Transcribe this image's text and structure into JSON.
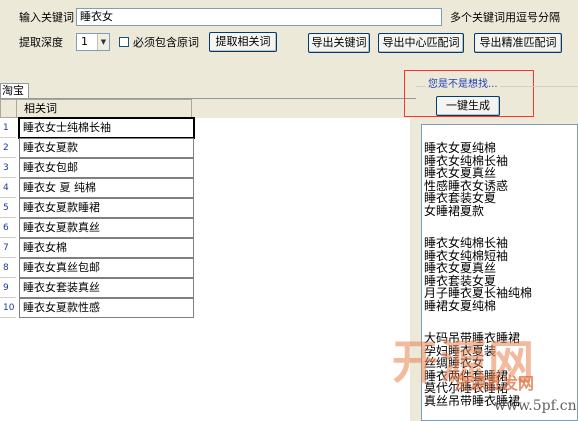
{
  "toolbar": {
    "keyword_label": "输入关键词",
    "keyword_value": "睡衣女",
    "keyword_hint": "多个关键词用逗号分隔",
    "depth_label": "提取深度",
    "depth_value": "1",
    "must_contain_label": "必须包含原词",
    "extract_button": "提取相关词",
    "export_keywords_button": "导出关键词",
    "export_center_button": "导出中心匹配词",
    "export_precise_button": "导出精准匹配词"
  },
  "tab": {
    "label": "淘宝"
  },
  "grid": {
    "header": "相关词",
    "rows": [
      {
        "num": "1",
        "text": "睡衣女士纯棉长袖"
      },
      {
        "num": "2",
        "text": "睡衣女夏款"
      },
      {
        "num": "3",
        "text": "睡衣女包邮"
      },
      {
        "num": "4",
        "text": "睡衣女 夏 纯棉"
      },
      {
        "num": "5",
        "text": "睡衣女夏款睡裙"
      },
      {
        "num": "6",
        "text": "睡衣女夏款真丝"
      },
      {
        "num": "7",
        "text": "睡衣女棉"
      },
      {
        "num": "8",
        "text": "睡衣女真丝包邮"
      },
      {
        "num": "9",
        "text": "睡衣女套装真丝"
      },
      {
        "num": "10",
        "text": "睡衣女夏款性感"
      }
    ]
  },
  "suggest": {
    "title": "您是不是想找...",
    "button": "一键生成"
  },
  "results": {
    "group1": [
      "睡衣女夏纯棉",
      "睡衣女纯棉长袖",
      "睡衣女夏真丝",
      "性感睡衣女诱惑",
      "睡衣套装女夏",
      "女睡裙夏款"
    ],
    "group2": [
      "睡衣女纯棉长袖",
      "睡衣女纯棉短袖",
      "睡衣女夏真丝",
      "睡衣套装女夏",
      "月子睡衣夏长袖纯棉",
      "睡裙女夏纯棉"
    ],
    "group3": [
      "大码吊带睡衣睡裙",
      "孕妇睡衣夏装",
      "丝绸睡衣女",
      "睡衣两件套睡裙",
      "莫代尔睡衣睡裙",
      "真丝吊带睡衣睡裙"
    ]
  },
  "watermark": {
    "text": "开源网",
    "sub": "货源批发网",
    "url": "www.5pf.cn"
  }
}
